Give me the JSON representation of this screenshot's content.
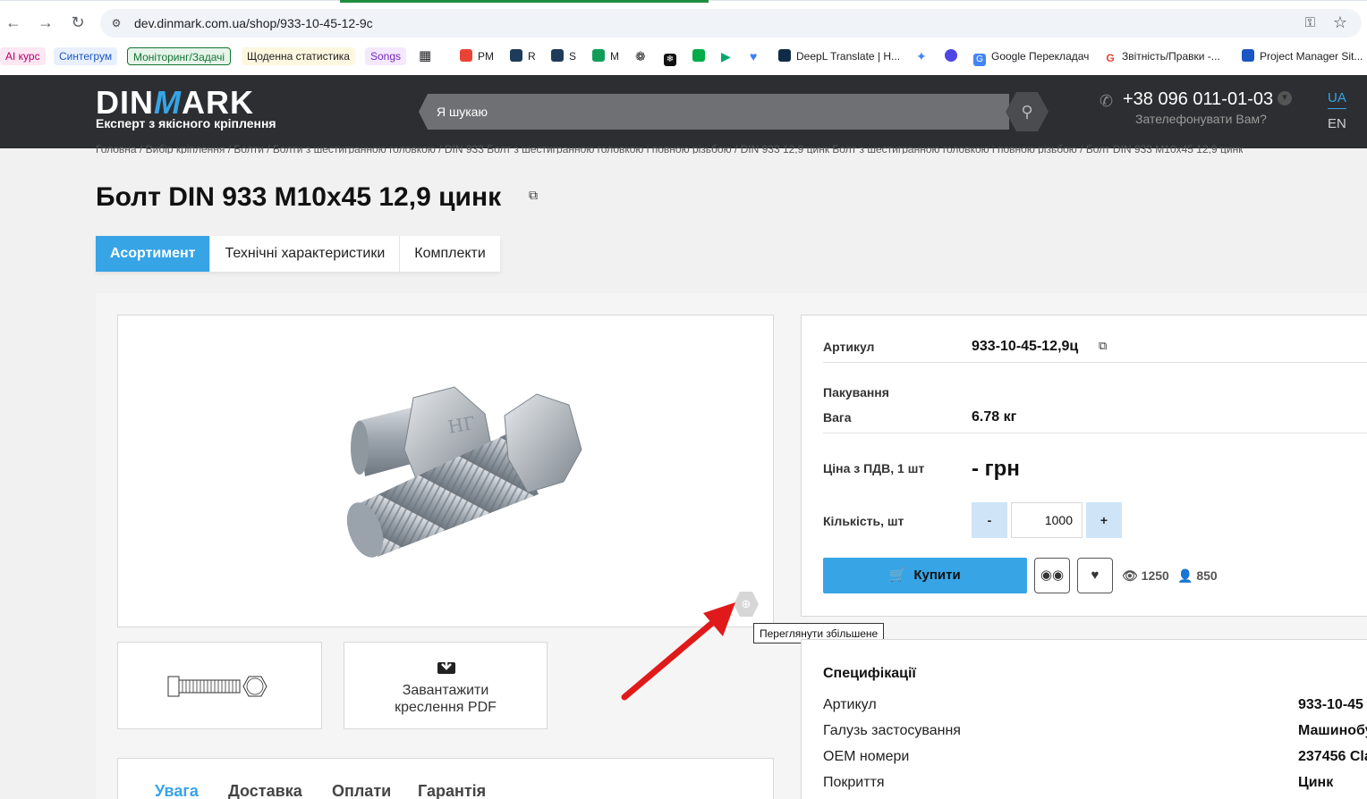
{
  "browser": {
    "url": "dev.dinmark.com.ua/shop/933-10-45-12-9c",
    "bookmarks": [
      {
        "label": "AI курс",
        "style": "chip",
        "bg": "#fde7f3",
        "color": "#b0006d"
      },
      {
        "label": "Синтегрум",
        "style": "chip",
        "bg": "#e8f0fe",
        "color": "#1a56c4"
      },
      {
        "label": "Моніторинг/Задачі",
        "style": "chip",
        "bg": "#e6f4ea",
        "color": "#137333"
      },
      {
        "label": "Щоденна статистика",
        "style": "chip",
        "bg": "#fef7e0",
        "color": "#202124"
      },
      {
        "label": "Songs",
        "style": "chip",
        "bg": "#f3e8fd",
        "color": "#7627bb"
      },
      {
        "label": "PM",
        "icon": "#ea4335"
      },
      {
        "label": "R",
        "icon": "#1f3b5a"
      },
      {
        "label": "S",
        "icon": "#1f3b5a"
      },
      {
        "label": "M",
        "icon": "#0f9d58"
      },
      {
        "label": "DeepL Translate | Н...",
        "icon": "#0f2b46"
      },
      {
        "label": "Google Перекладач",
        "icon": "#4285f4"
      },
      {
        "label": "Звітність/Правки -...",
        "icon": "#ffffff"
      },
      {
        "label": "Project Manager Sit...",
        "icon": "#1a56c4"
      }
    ]
  },
  "header": {
    "logo_left": "DIN",
    "logo_mid": "M",
    "logo_right": "ARK",
    "tagline": "Експерт з якісного кріплення",
    "search_placeholder": "Я шукаю",
    "phone": "+38 096 011-01-03",
    "callback": "Зателефонувати Вам?",
    "lang_ua": "UA",
    "lang_en": "EN"
  },
  "breadcrumb": {
    "items": [
      "Головна",
      "Вибір кріплення",
      "Болти",
      "Болти з шестигранною головкою",
      "DIN 933 Болт з шестигранною головкою і повною різьбою",
      "DIN 933 12,9 цинк Болт з шестигранною головкою і повною різьбою"
    ],
    "current": "Болт DIN 933 M10x45 12,9 цинк",
    "separator": "/"
  },
  "product": {
    "title": "Болт DIN 933 M10x45 12,9 цинк",
    "tabs": [
      "Асортимент",
      "Технічні характеристики",
      "Комплекти"
    ],
    "zoom_tooltip": "Переглянути збільшене",
    "pdf_label_line1": "Завантажити",
    "pdf_label_line2": "креслення PDF",
    "info_tabs": [
      "Увага",
      "Доставка",
      "Оплати",
      "Гарантія"
    ]
  },
  "buy": {
    "article_label": "Артикул",
    "article_value": "933-10-45-12,9ц",
    "packing_label": "Пакування",
    "weight_label": "Вага",
    "weight_value": "6.78 кг",
    "price_label": "Ціна з ПДВ, 1 шт",
    "price_value": "- грн",
    "qty_label": "Кількість, шт",
    "qty_minus": "-",
    "qty_value": "1000",
    "qty_plus": "+",
    "buy_label": "Купити",
    "views": "1250",
    "users": "850"
  },
  "specs": {
    "title": "Специфікації",
    "rows": [
      {
        "label": "Артикул",
        "value": "933-10-45"
      },
      {
        "label": "Галузь застосування",
        "value": "Машинобу"
      },
      {
        "label": "OEM номери",
        "value": "237456 Cla"
      },
      {
        "label": "Покриття",
        "value": "Цинк"
      }
    ]
  },
  "colors": {
    "accent": "#37a4e6",
    "header_bg": "#2c2e31",
    "arrow": "#e01a1a"
  }
}
